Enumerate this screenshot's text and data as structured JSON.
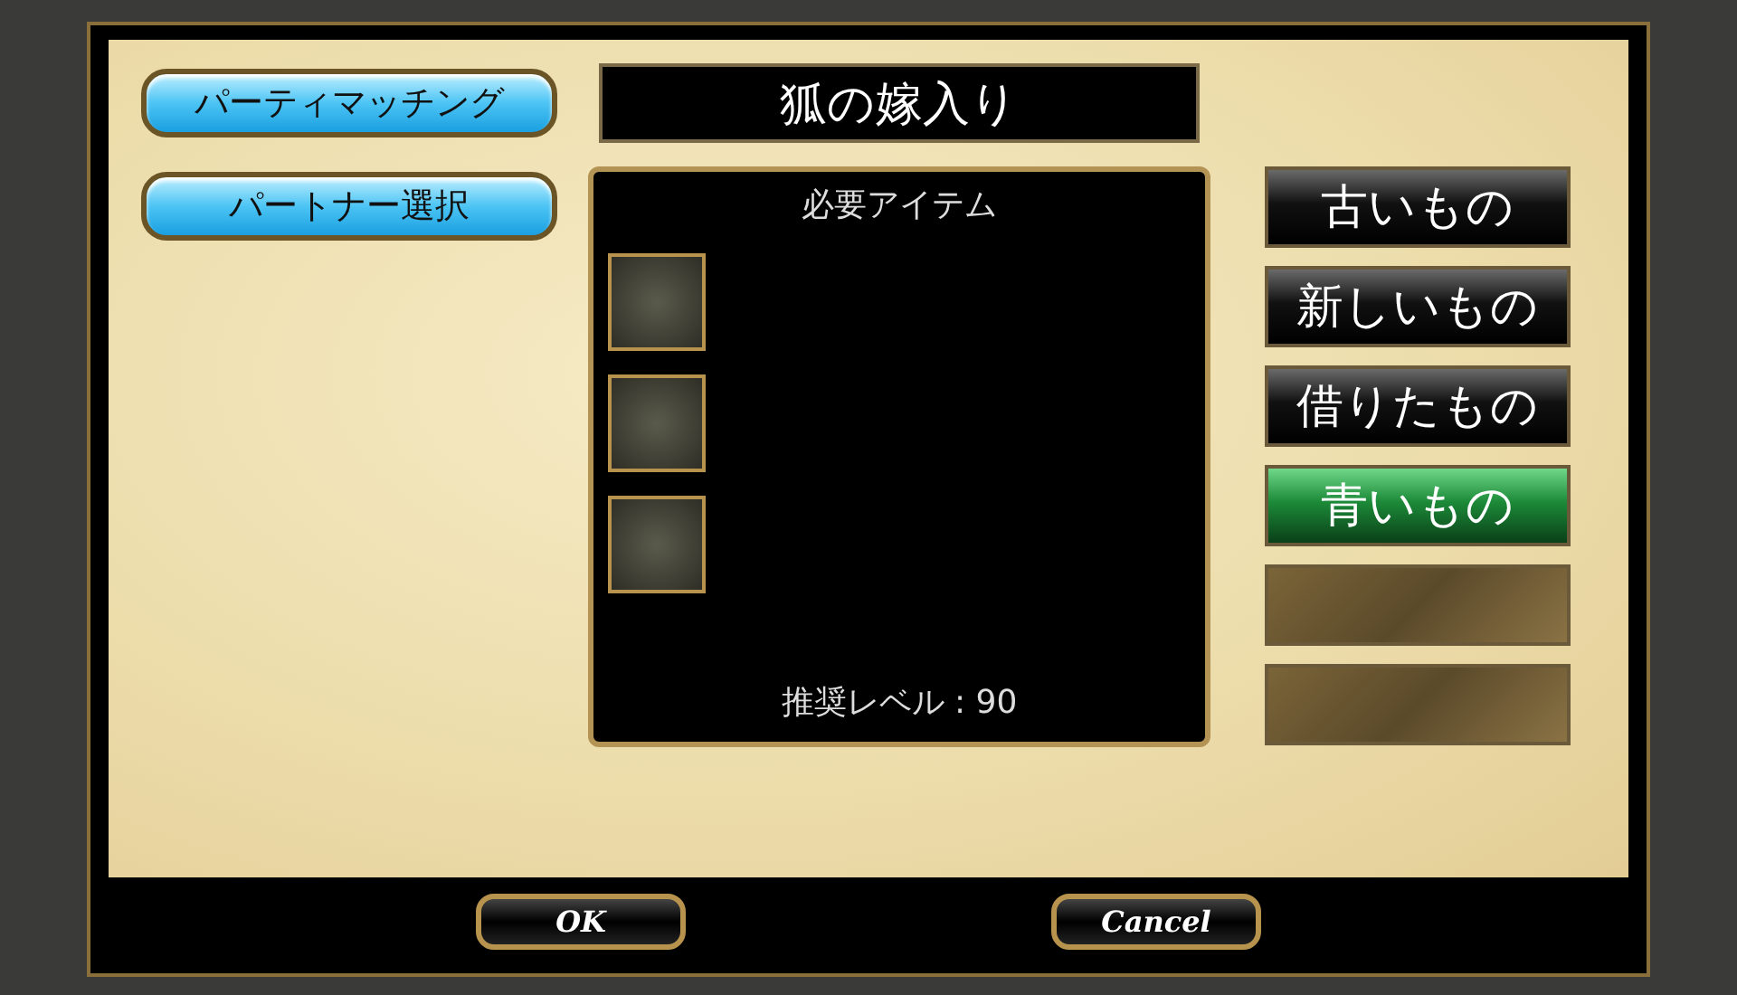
{
  "side_buttons": [
    {
      "label": "パーティマッチング"
    },
    {
      "label": "パートナー選択"
    }
  ],
  "quest": {
    "title": "狐の嫁入り",
    "panel_title": "必要アイテム",
    "item_slots": [
      {
        "kind": "empty"
      },
      {
        "kind": "empty"
      },
      {
        "kind": "empty"
      }
    ],
    "recommended_level": "推奨レベル : 90"
  },
  "options": [
    {
      "kind": "choice",
      "label": "古いもの",
      "selected": false
    },
    {
      "kind": "choice",
      "label": "新しいもの",
      "selected": false
    },
    {
      "kind": "choice",
      "label": "借りたもの",
      "selected": false
    },
    {
      "kind": "choice",
      "label": "青いもの",
      "selected": true
    },
    {
      "kind": "empty"
    },
    {
      "kind": "empty"
    }
  ],
  "dialog_buttons": [
    "OK",
    "Cancel"
  ]
}
